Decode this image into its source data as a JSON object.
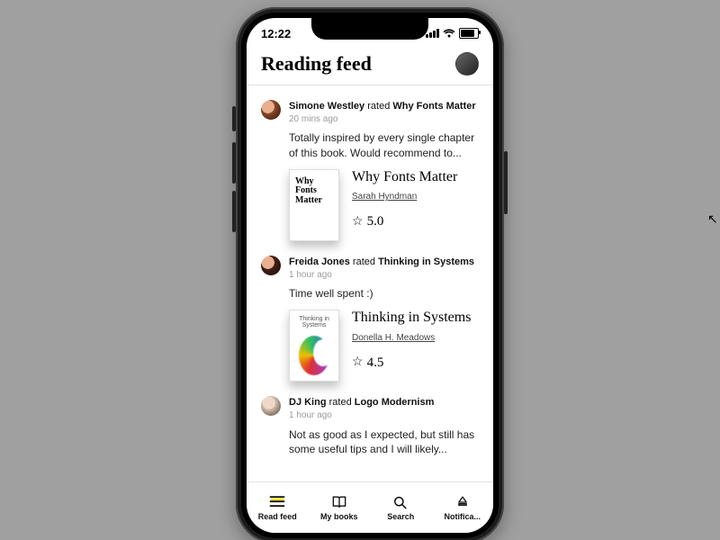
{
  "status": {
    "time": "12:22"
  },
  "header": {
    "title": "Reading feed"
  },
  "rated_verb": "rated",
  "feed": [
    {
      "user": "Simone Westley",
      "book_ref": "Why Fonts Matter",
      "time": "20 mins ago",
      "review": "Totally inspired by every single chapter of this book. Would recommend to...",
      "book": {
        "title": "Why Fonts Matter",
        "author": "Sarah Hyndman",
        "rating": "5.0",
        "cover_text": "Why\nFonts\nMatter"
      }
    },
    {
      "user": "Freida Jones",
      "book_ref": "Thinking in Systems",
      "time": "1 hour ago",
      "review": "Time well spent :)",
      "book": {
        "title": "Thinking in Systems",
        "author": "Donella H. Meadows",
        "rating": "4.5",
        "cover_text": "Thinking in Systems"
      }
    },
    {
      "user": "DJ King",
      "book_ref": "Logo Modernism",
      "time": "1 hour ago",
      "review": "Not as good as I expected, but still has some useful tips and I will likely..."
    }
  ],
  "tabs": [
    {
      "label": "Read feed"
    },
    {
      "label": "My books"
    },
    {
      "label": "Search"
    },
    {
      "label": "Notifica..."
    }
  ]
}
